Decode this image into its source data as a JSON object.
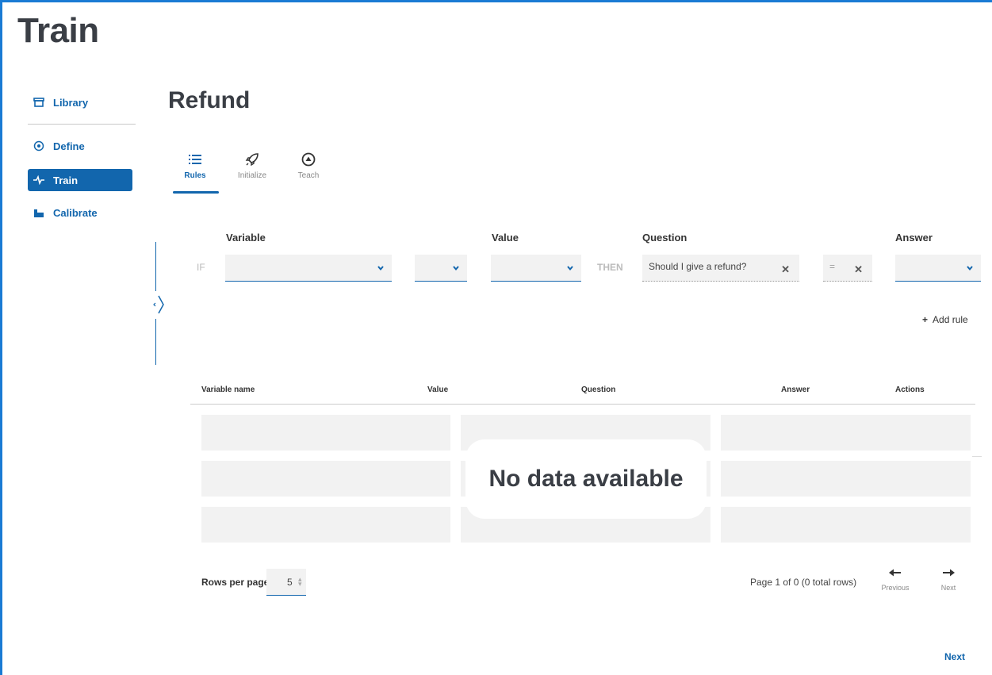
{
  "app": {
    "title": "Train"
  },
  "sidebar": {
    "items": [
      {
        "label": "Library",
        "icon": "archive-icon"
      },
      {
        "label": "Define",
        "icon": "target-icon"
      },
      {
        "label": "Train",
        "icon": "pulse-icon",
        "active": true
      },
      {
        "label": "Calibrate",
        "icon": "bar-chart-icon"
      }
    ]
  },
  "page": {
    "title": "Refund"
  },
  "tabs": [
    {
      "label": "Rules",
      "icon": "list-icon",
      "active": true
    },
    {
      "label": "Initialize",
      "icon": "rocket-icon"
    },
    {
      "label": "Teach",
      "icon": "teach-icon"
    }
  ],
  "rule": {
    "headers": {
      "variable": "Variable",
      "value": "Value",
      "question": "Question",
      "answer": "Answer"
    },
    "if_keyword": "IF",
    "then_keyword": "THEN",
    "question_value": "Should I give a refund?",
    "operator_value": "=",
    "add_rule_label": "Add rule"
  },
  "table": {
    "columns": [
      "Variable name",
      "Value",
      "Question",
      "Answer",
      "Actions"
    ],
    "empty_message": "No data available"
  },
  "pagination": {
    "rows_per_page_label": "Rows per page",
    "rows_per_page_value": "5",
    "page_info": "Page 1 of 0 (0 total rows)",
    "previous_label": "Previous",
    "next_label": "Next"
  },
  "footer": {
    "next_label": "Next"
  },
  "colors": {
    "accent": "#1266ad",
    "frame": "#1a7bd4",
    "skeleton": "#f2f2f2"
  }
}
